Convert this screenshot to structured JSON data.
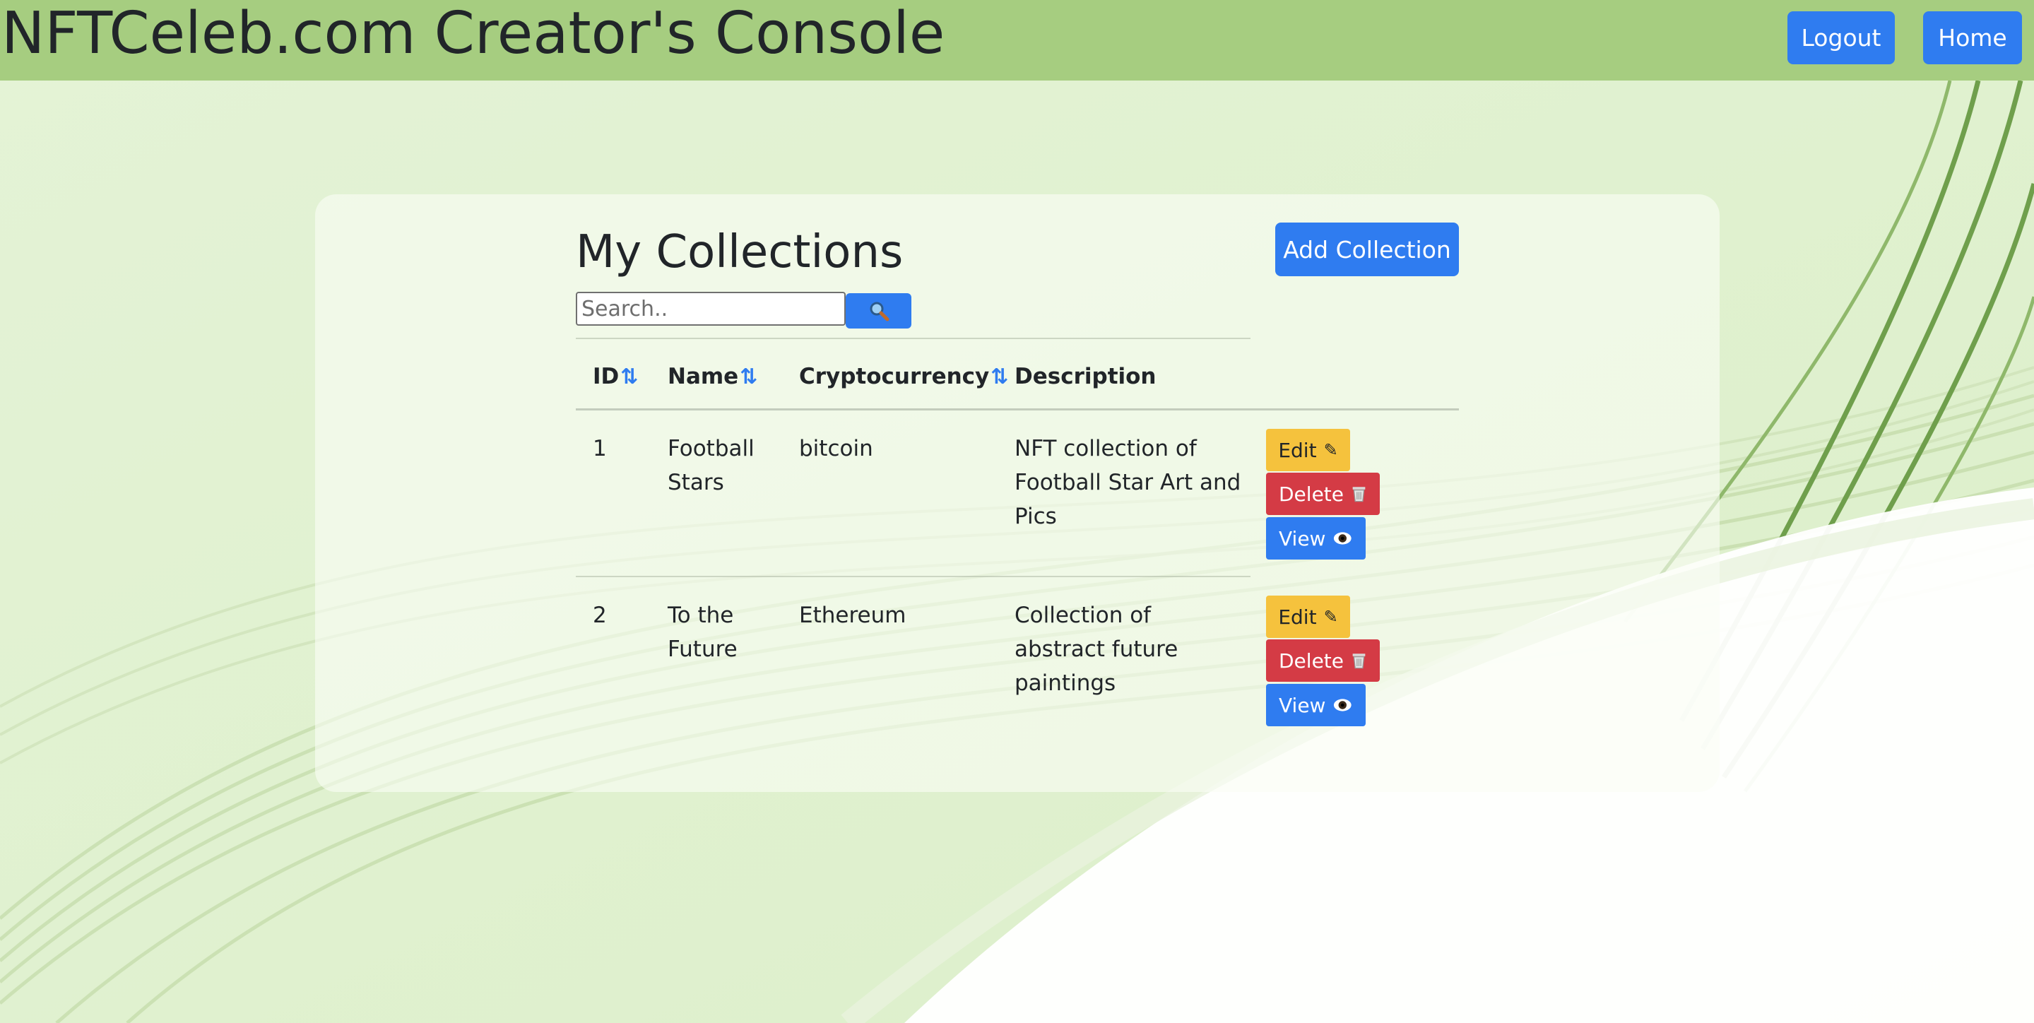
{
  "header": {
    "title": "NFTCeleb.com Creator's Console",
    "logout_label": "Logout",
    "home_label": "Home"
  },
  "main": {
    "heading": "My Collections",
    "add_button_label": "Add Collection",
    "search": {
      "placeholder": "Search..",
      "value": "",
      "button_icon": "search-icon"
    },
    "table": {
      "columns": [
        {
          "label": "ID",
          "sortable": true
        },
        {
          "label": "Name",
          "sortable": true
        },
        {
          "label": "Cryptocurrency",
          "sortable": true
        },
        {
          "label": "Description",
          "sortable": false
        }
      ],
      "sort_glyph": "⇅",
      "rows": [
        {
          "id": "1",
          "name": "Football Stars",
          "cryptocurrency": "bitcoin",
          "description": "NFT collection of Football Star Art and Pics"
        },
        {
          "id": "2",
          "name": "To the Future",
          "cryptocurrency": "Ethereum",
          "description": "Collection of abstract future paintings"
        }
      ],
      "actions": {
        "edit_label": "Edit",
        "delete_label": "Delete",
        "view_label": "View"
      }
    }
  },
  "colors": {
    "topbar": "#a6cd80",
    "background": "#e2f2d4",
    "primary": "#2f7cf0",
    "warning": "#f5c23d",
    "danger": "#d43b45"
  }
}
